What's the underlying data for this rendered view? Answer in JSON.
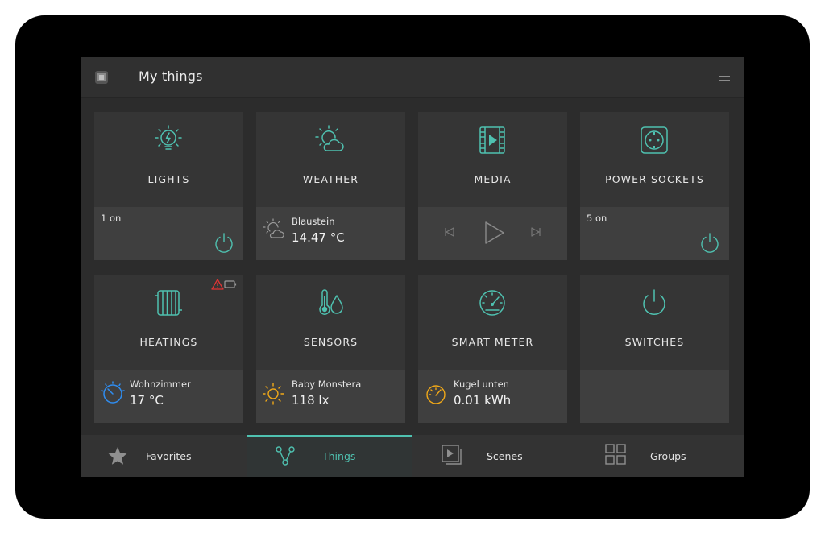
{
  "header": {
    "title": "My things",
    "menu_icon": "hamburger-menu-icon",
    "app_icon": "app-square-icon"
  },
  "colors": {
    "accent": "#4fc1b0",
    "sun": "#f0a818",
    "heating": "#2f8df0",
    "warning": "#e03535"
  },
  "tiles": [
    {
      "label": "LIGHTS",
      "icon": "bulb-icon",
      "status": "1 on"
    },
    {
      "label": "WEATHER",
      "icon": "weather-sun-cloud-icon",
      "location": "Blaustein",
      "value": "14.47 °C"
    },
    {
      "label": "MEDIA",
      "icon": "film-play-icon"
    },
    {
      "label": "POWER SOCKETS",
      "icon": "power-socket-icon",
      "status": "5 on"
    },
    {
      "label": "HEATINGS",
      "icon": "radiator-icon",
      "room": "Wohnzimmer",
      "value": "17 °C"
    },
    {
      "label": "SENSORS",
      "icon": "thermometer-drop-icon",
      "name": "Baby Monstera",
      "value": "118 lx"
    },
    {
      "label": "SMART METER",
      "icon": "gauge-icon",
      "name": "Kugel unten",
      "value": "0.01 kWh"
    },
    {
      "label": "SWITCHES",
      "icon": "power-icon"
    }
  ],
  "nav": [
    {
      "label": "Favorites",
      "icon": "star-icon",
      "active": false
    },
    {
      "label": "Things",
      "icon": "things-network-icon",
      "active": true
    },
    {
      "label": "Scenes",
      "icon": "scenes-play-icon",
      "active": false
    },
    {
      "label": "Groups",
      "icon": "groups-grid-icon",
      "active": false
    }
  ]
}
